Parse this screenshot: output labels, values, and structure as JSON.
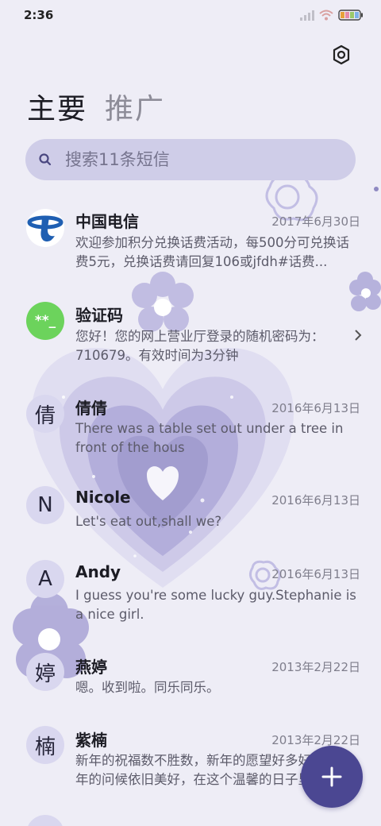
{
  "status_bar": {
    "time": "2:36"
  },
  "tabs": [
    {
      "label": "主要",
      "active": true
    },
    {
      "label": "推广",
      "active": false
    }
  ],
  "search": {
    "placeholder": "搜索11条短信"
  },
  "messages": [
    {
      "avatar_icon": "china-telecom-logo",
      "name": "中国电信",
      "date": "2017年6月30日",
      "preview": "欢迎参加积分兑换话费活动，每500分可兑换话费5元，兑换话费请回复106或jfdh#话费..."
    },
    {
      "avatar_icon": "verification-code-icon",
      "avatar_text": "**_",
      "name": "验证码",
      "date": "",
      "preview": "您好！您的网上营业厅登录的随机密码为：710679。有效时间为3分钟",
      "has_chevron": true
    },
    {
      "avatar_text": "倩",
      "name": "倩倩",
      "date": "2016年6月13日",
      "preview": "There was a table set out under a tree in front of the hous"
    },
    {
      "avatar_text": "N",
      "name": "Nicole",
      "date": "2016年6月13日",
      "preview": "Let's eat out,shall we?"
    },
    {
      "avatar_text": "A",
      "name": "Andy",
      "date": "2016年6月13日",
      "preview": "I guess you're some lucky guy.Stephanie is a nice girl."
    },
    {
      "avatar_text": "婷",
      "name": "燕婷",
      "date": "2013年2月22日",
      "preview": "嗯。收到啦。同乐同乐。"
    },
    {
      "avatar_text": "楠",
      "name": "紫楠",
      "date": "2013年2月22日",
      "preview": "新年的祝福数不胜数，新年的愿望好多好多，新年的问候依旧美好，在这个温馨的日子里"
    }
  ],
  "colors": {
    "background": "#eeedf6",
    "search_bg": "#cfcde8",
    "fab": "#4b4792",
    "avatar_bg": "#d9d7ef",
    "verification_avatar": "#6cd35c",
    "telecom_blue": "#1f5fb2"
  },
  "fab": {
    "icon": "plus-icon"
  }
}
